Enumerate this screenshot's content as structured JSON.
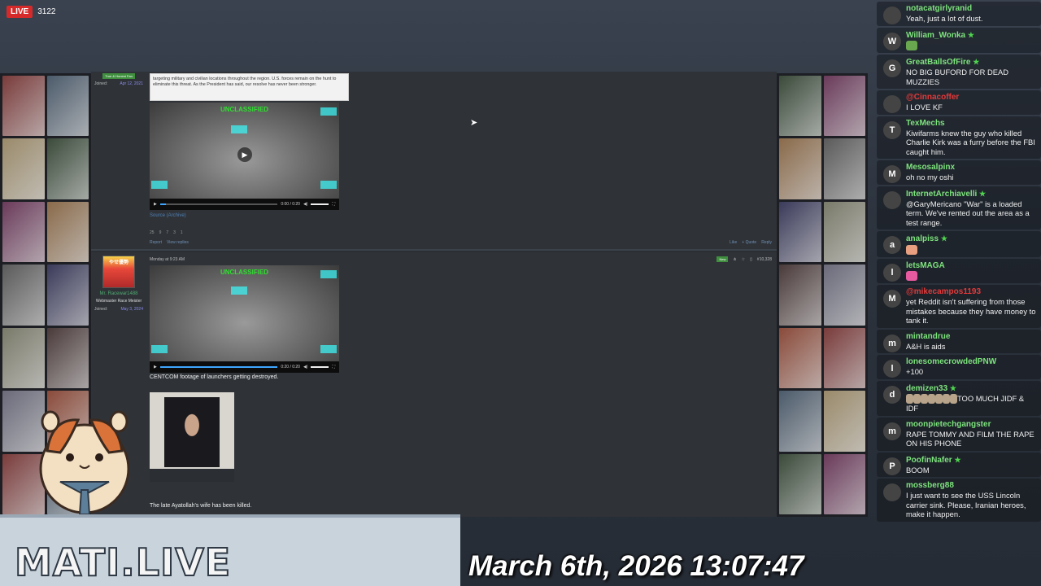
{
  "stream": {
    "live_label": "LIVE",
    "viewer_count": "3122",
    "brand": "MATI.LIVE",
    "datetime": "March 6th, 2026 13:07:47"
  },
  "post1": {
    "rank_badge": "True & Honest Fan",
    "joined_label": "Joined:",
    "joined_date": "Apr 12, 2021",
    "quote_text": "targeting military and civilian locations throughout the region. U.S. forces remain on the hunt to eliminate this threat. As the President has said, our resolve has never been stronger.",
    "video_overlay": "UNCLASSIFIED",
    "video_time": "0:00 / 0:20",
    "source_link": "Source (Archive)",
    "reactions": [
      "25",
      "9",
      "7",
      "3",
      "1"
    ],
    "links": [
      "Report",
      "View replies"
    ],
    "actions": [
      "Like",
      "+ Quote",
      "Reply"
    ]
  },
  "post2": {
    "avatar_text": "やせ優勢",
    "username": "Mr. Racewar1488",
    "user_title": "Webmaster Race Meister",
    "joined_label": "Joined:",
    "joined_date": "May 3, 2024",
    "timestamp": "Monday at 9:23 AM",
    "new_badge": "New",
    "post_number": "#10,328",
    "video_overlay": "UNCLASSIFIED",
    "video_time": "0:20 / 0:20",
    "video_progress": 1.0,
    "video_caption": "CENTCOM footage of launchers getting destroyed.",
    "image_caption": "The late Ayatollah's wife has been killed."
  },
  "chat": [
    {
      "name": "notacatgirlyranid",
      "text": "Yeah, just a lot of dust.",
      "avatar": "",
      "color": "#7de37d"
    },
    {
      "name": "William_Wonka",
      "star": "★",
      "text": "",
      "avatar": "W",
      "emote": "#6aa84f"
    },
    {
      "name": "GreatBallsOfFire",
      "star": "★",
      "text": "NO BIG BUFORD FOR DEAD MUZZIES",
      "avatar": "G"
    },
    {
      "name": "@Cinnacoffer",
      "text": "I LOVE KF",
      "avatar": "",
      "red": true
    },
    {
      "name": "TexMechs",
      "text": "Kiwifarms knew the guy who killed Charlie Kirk was a furry before the FBI caught him.",
      "avatar": "T"
    },
    {
      "name": "Mesosalpinx",
      "text": "oh no my oshi",
      "avatar": "M"
    },
    {
      "name": "InternetArchiavelli",
      "star": "★",
      "text": "@GaryMericano \"War\" is a loaded term. We've rented out the area as a test range.",
      "avatar": ""
    },
    {
      "name": "analpiss",
      "star": "★",
      "text": "",
      "avatar": "a",
      "emote": "#e8a080"
    },
    {
      "name": "letsMAGA",
      "text": "",
      "avatar": "l",
      "emote": "#e85aa0"
    },
    {
      "name": "@mikecampos1193",
      "text": "yet Reddit isn't suffering from those mistakes because they have money to tank it.",
      "avatar": "M",
      "red": true
    },
    {
      "name": "mintandrue",
      "text": "A&H is aids",
      "avatar": "m"
    },
    {
      "name": "lonesomecrowdedPNW",
      "text": "+100",
      "avatar": "l"
    },
    {
      "name": "demizen33",
      "star": "★",
      "text": "TOO MUCH JIDF & IDF",
      "avatar": "d",
      "emote_row": 7
    },
    {
      "name": "moonpietechgangster",
      "text": "RAPE TOMMY AND FILM THE RAPE ON HIS PHONE",
      "avatar": "m"
    },
    {
      "name": "PoofinNafer",
      "star": "★",
      "text": "BOOM",
      "avatar": "P"
    },
    {
      "name": "mossberg88",
      "text": "I just want to see the USS Lincoln carrier sink. Please, Iranian heroes, make it happen.",
      "avatar": ""
    }
  ]
}
